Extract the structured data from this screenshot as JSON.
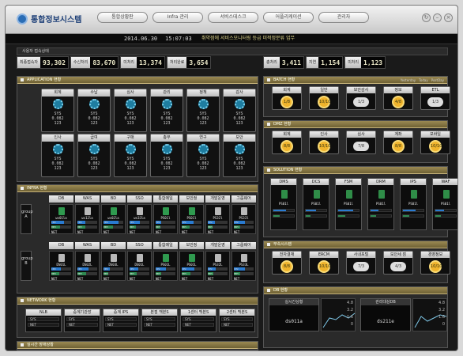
{
  "app": {
    "title": "통합정보시스템"
  },
  "nav": {
    "tabs": [
      "통합상황판",
      "Infra 관리",
      "서비스데스크",
      "어플리케이션",
      "관리자"
    ]
  },
  "window_buttons": [
    "refresh-icon",
    "minimize-icon",
    "close-icon"
  ],
  "ticker": {
    "date": "2014.06.30",
    "time": "15:07:03",
    "message": "취약점에 서비스모니터링 등급 미적정분류 업무"
  },
  "breadcrumb": "사용자 접속상태",
  "kpis": [
    {
      "label": "최종접속자",
      "value": "93,302"
    },
    {
      "label": "수신처리",
      "value": "83,670"
    },
    {
      "label": "미처리",
      "value": "13,374"
    },
    {
      "label": "처리완료",
      "value": "3,654"
    },
    {
      "label": "총처리",
      "value": "3,411"
    },
    {
      "label": "지연",
      "value": "1,154"
    },
    {
      "label": "미처리",
      "value": "1,123"
    }
  ],
  "application": {
    "title": "APPLICATION 현황",
    "apps": [
      {
        "name": "회계",
        "rows": [
          "SYS",
          "0.082",
          "123"
        ]
      },
      {
        "name": "수납",
        "rows": [
          "SYS",
          "0.082",
          "123"
        ]
      },
      {
        "name": "심사",
        "rows": [
          "SYS",
          "0.082",
          "123"
        ]
      },
      {
        "name": "관리",
        "rows": [
          "SYS",
          "0.082",
          "123"
        ]
      },
      {
        "name": "정책",
        "rows": [
          "SYS",
          "0.082",
          "123"
        ]
      },
      {
        "name": "감사",
        "rows": [
          "SYS",
          "0.082",
          "123"
        ]
      },
      {
        "name": "인사",
        "rows": [
          "SYS",
          "0.082",
          "123"
        ]
      },
      {
        "name": "급여",
        "rows": [
          "SYS",
          "0.082",
          "123"
        ]
      },
      {
        "name": "구매",
        "rows": [
          "SYS",
          "0.082",
          "123"
        ]
      },
      {
        "name": "총무",
        "rows": [
          "SYS",
          "0.082",
          "123"
        ]
      },
      {
        "name": "연구",
        "rows": [
          "SYS",
          "0.082",
          "123"
        ]
      },
      {
        "name": "보안",
        "rows": [
          "SYS",
          "0.082",
          "123"
        ]
      }
    ]
  },
  "infra": {
    "title": "INFRA 현황",
    "headers": [
      "DB",
      "WAS",
      "BD",
      "SSO",
      "통합메일",
      "보안정",
      "개발운영",
      "그룹웨어"
    ],
    "group_a": "group A",
    "group_b": "group B",
    "servers_a": [
      {
        "name": "ws01la",
        "icon": "green",
        "cpu": 65,
        "mem": 42
      },
      {
        "name": "ws12la",
        "icon": "gray",
        "cpu": 40,
        "mem": 40
      },
      {
        "name": "ws02la",
        "icon": "green",
        "cpu": 75,
        "mem": 48
      },
      {
        "name": "ws33la",
        "icon": "gray",
        "cpu": 52,
        "mem": 30
      },
      {
        "name": "PS01l",
        "icon": "green",
        "cpu": 28,
        "mem": 22
      },
      {
        "name": "PS01l",
        "icon": "green",
        "cpu": 60,
        "mem": 40
      },
      {
        "name": "PS32l",
        "icon": "gray",
        "cpu": 35,
        "mem": 25
      },
      {
        "name": "PS33l",
        "icon": "gray",
        "cpu": 55,
        "mem": 30
      }
    ],
    "servers_b": [
      {
        "name": "DS01L",
        "icon": "gray",
        "cpu": 48,
        "mem": 38
      },
      {
        "name": "DS02L",
        "icon": "gray",
        "cpu": 55,
        "mem": 44
      },
      {
        "name": "DS03L",
        "icon": "gray",
        "cpu": 30,
        "mem": 22
      },
      {
        "name": "DS01L",
        "icon": "gray",
        "cpu": 42,
        "mem": 34
      },
      {
        "name": "PS01L",
        "icon": "green",
        "cpu": 50,
        "mem": 28
      },
      {
        "name": "PS01L",
        "icon": "green",
        "cpu": 65,
        "mem": 45
      },
      {
        "name": "PS32L",
        "icon": "gray",
        "cpu": 38,
        "mem": 26
      },
      {
        "name": "PS33L",
        "icon": "gray",
        "cpu": 57,
        "mem": 31
      }
    ],
    "bar_labels": [
      "CPU",
      "MEM"
    ],
    "net_label": "NET"
  },
  "network": {
    "title": "NETWORK 현황",
    "items": [
      {
        "name": "NLB",
        "rows": [
          "SYS",
          "NET"
        ]
      },
      {
        "name": "중계기관망",
        "rows": [
          "SYS",
          "NET"
        ]
      },
      {
        "name": "중계 IPS",
        "rows": [
          "SYS",
          "NET"
        ]
      },
      {
        "name": "본점 백본S",
        "rows": [
          "SYS",
          "NET"
        ]
      },
      {
        "name": "1센터 백본S",
        "rows": [
          "SYS",
          "NET"
        ]
      },
      {
        "name": "2센터 백본S",
        "rows": [
          "SYS",
          "NET"
        ]
      }
    ]
  },
  "batch": {
    "title": "BATCH 현황",
    "legend": [
      "Yesterday",
      "Today",
      "PostDay"
    ],
    "items": [
      {
        "name": "회계",
        "status": "sun",
        "value": "1/8"
      },
      {
        "name": "일반",
        "status": "sun",
        "value": "10/10"
      },
      {
        "name": "보안감사",
        "status": "cloud",
        "value": "1/3"
      },
      {
        "name": "정보",
        "status": "sun",
        "value": "4/8"
      },
      {
        "name": "ETL",
        "status": "cloud",
        "value": "1/3"
      }
    ]
  },
  "dmz": {
    "title": "DMZ 현황",
    "items": [
      {
        "name": "회계",
        "status": "sun",
        "value": "8/8"
      },
      {
        "name": "인사",
        "status": "sun",
        "value": "10/10"
      },
      {
        "name": "심사",
        "status": "cloud",
        "value": "7/8"
      },
      {
        "name": "계좌",
        "status": "sun",
        "value": "8/8"
      },
      {
        "name": "모바일",
        "status": "sun",
        "value": "10/10"
      }
    ]
  },
  "solution": {
    "title": "SOLUTION 현황",
    "items": [
      {
        "name": "DMS",
        "dev": "PS01l",
        "cpu": 60,
        "mem": 30
      },
      {
        "name": "DCS",
        "dev": "PS01l",
        "cpu": 50,
        "mem": 22
      },
      {
        "name": "FSM",
        "dev": "PS01l",
        "cpu": 72,
        "mem": 35
      },
      {
        "name": "DRM",
        "dev": "PS01l",
        "cpu": 40,
        "mem": 25
      },
      {
        "name": "IPS",
        "dev": "PS01l",
        "cpu": 62,
        "mem": 31
      },
      {
        "name": "WAF",
        "dev": "PS01l",
        "cpu": 44,
        "mem": 26
      }
    ]
  },
  "relay": {
    "title": "부속시스템",
    "items": [
      {
        "name": "전자결재",
        "status": "sun",
        "value": "8/8"
      },
      {
        "name": "ERCM",
        "status": "sun",
        "value": "10/10"
      },
      {
        "name": "사내포털",
        "status": "cloud",
        "value": "7/3"
      },
      {
        "name": "보안세 점",
        "status": "cloud",
        "value": "4/3"
      },
      {
        "name": "경영정보",
        "status": "sun",
        "value": "10/10"
      }
    ]
  },
  "db": {
    "title": "DB 현황",
    "left_box": {
      "label": "실시간상황",
      "value": "ds011a"
    },
    "right_box": {
      "label": "관리대상DB",
      "value": "ds211e"
    },
    "left_ticks": [
      "4.8",
      "3.2",
      "1.6",
      "0"
    ],
    "right_ticks": [
      "4.8",
      "3.2",
      "1.6",
      "0"
    ]
  },
  "alert": {
    "title": "실시간 장애상황"
  }
}
